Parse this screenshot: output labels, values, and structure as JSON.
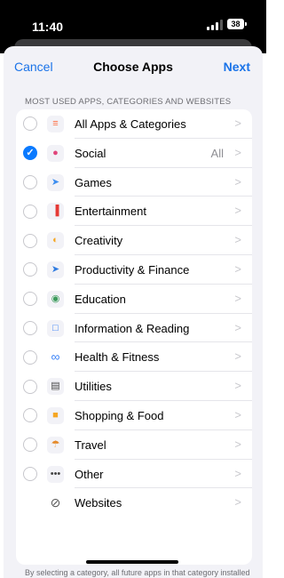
{
  "status_bar": {
    "time": "11:40",
    "battery": "38"
  },
  "nav": {
    "cancel": "Cancel",
    "title": "Choose Apps",
    "next": "Next"
  },
  "section_header": "MOST USED APPS, CATEGORIES AND WEBSITES",
  "accent_color": "#1a73e8",
  "items": [
    {
      "label": "All Apps & Categories",
      "icon": "stack-icon",
      "checked": false,
      "value": ""
    },
    {
      "label": "Social",
      "icon": "social-bubble-icon",
      "checked": true,
      "value": "All"
    },
    {
      "label": "Games",
      "icon": "rocket-icon",
      "checked": false,
      "value": ""
    },
    {
      "label": "Entertainment",
      "icon": "popcorn-icon",
      "checked": false,
      "value": ""
    },
    {
      "label": "Creativity",
      "icon": "palette-icon",
      "checked": false,
      "value": ""
    },
    {
      "label": "Productivity & Finance",
      "icon": "paper-plane-icon",
      "checked": false,
      "value": ""
    },
    {
      "label": "Education",
      "icon": "globe-icon",
      "checked": false,
      "value": ""
    },
    {
      "label": "Information & Reading",
      "icon": "book-icon",
      "checked": false,
      "value": ""
    },
    {
      "label": "Health & Fitness",
      "icon": "bicycle-icon",
      "checked": false,
      "value": ""
    },
    {
      "label": "Utilities",
      "icon": "calculator-icon",
      "checked": false,
      "value": ""
    },
    {
      "label": "Shopping & Food",
      "icon": "shopping-bag-icon",
      "checked": false,
      "value": ""
    },
    {
      "label": "Travel",
      "icon": "beach-umbrella-icon",
      "checked": false,
      "value": ""
    },
    {
      "label": "Other",
      "icon": "ellipsis-icon",
      "checked": false,
      "value": ""
    },
    {
      "label": "Websites",
      "icon": "compass-icon",
      "checked": null,
      "value": ""
    }
  ],
  "footer_note": "By selecting a category, all future apps in that category installed from the App Store will be included in the limit."
}
